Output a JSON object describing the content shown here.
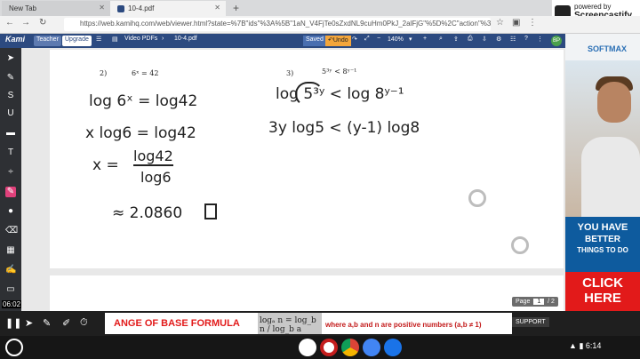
{
  "browser": {
    "tabs": [
      {
        "label": "New Tab"
      },
      {
        "label": "10-4.pdf"
      }
    ],
    "url": "https://web.kamihq.com/web/viewer.html?state=%7B\"ids\"%3A%5B\"1aN_V4FjTe0sZxdNL9cuHm0PkJ_2alFjG\"%5D%2C\"action\"%3A\"op..."
  },
  "extension": {
    "line1": "powered by",
    "line2": "Screencastify"
  },
  "kami": {
    "logo": "Kami",
    "teacher": "Teacher",
    "upgrade": "Upgrade",
    "video_pdfs": "Video PDFs",
    "filename": "10-4.pdf",
    "saved": "Saved",
    "undo": "Undo",
    "zoom": "140%",
    "avatar": "BP"
  },
  "doc": {
    "problem2_number": "2)",
    "problem2_eq": "6ˣ = 42",
    "problem3_number": "3)",
    "problem3_eq": "5³ʸ < 8ʸ⁻¹",
    "work2_line1": "log 6ˣ = log42",
    "work2_line2": "x log6 = log42",
    "work2_x": "x =",
    "work2_num": "log42",
    "work2_den": "log6",
    "work2_answer": "≈ 2.0860",
    "work3_line1": "log 5³ʸ < log 8ʸ⁻¹",
    "work3_line2": "3y log5 < (y-1) log8"
  },
  "pager": {
    "label": "Page",
    "current": "1",
    "total": "/ 2"
  },
  "timestamp": "06:02",
  "slide": {
    "title": "ANGE OF BASE FORMULA",
    "formula": "logₐ n = log_b n / log_b a",
    "note": "where a,b and n are positive numbers (a,b ≠ 1)"
  },
  "support": "SUPPORT",
  "ad": {
    "brand": "SOFTMAX",
    "line1": "YOU HAVE",
    "line2": "BETTER",
    "line3": "THINGS TO DO",
    "cta": "CLICK HERE"
  },
  "shelf": {
    "status": "6:14"
  }
}
